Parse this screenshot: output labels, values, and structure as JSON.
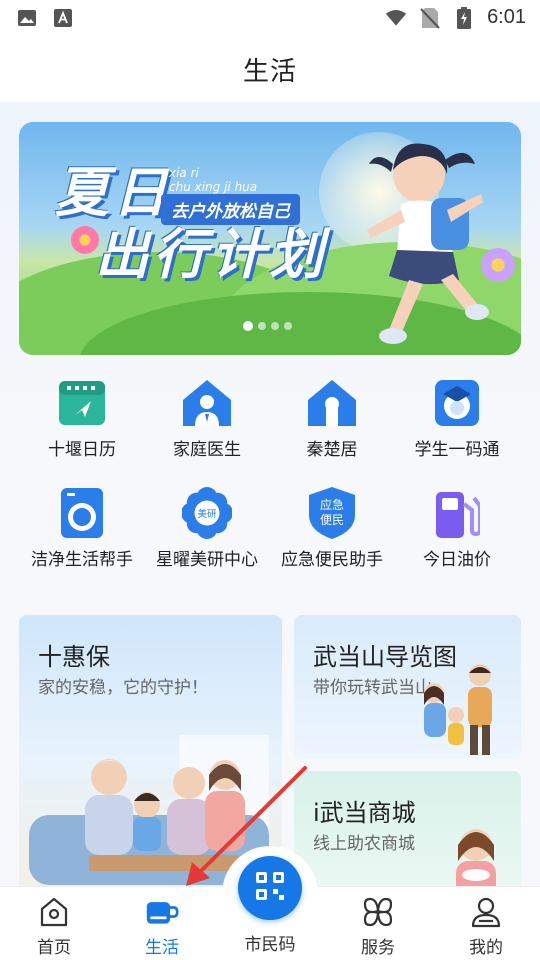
{
  "status_bar": {
    "time": "6:01",
    "left_icons": [
      "image-icon",
      "font-icon"
    ],
    "right_icons": [
      "wifi-icon",
      "no-sim-icon",
      "battery-icon"
    ]
  },
  "header": {
    "title": "生活"
  },
  "banner": {
    "title_line1": "夏日",
    "title_line2": "出行计划",
    "pinyin_line1": "xia ri",
    "pinyin_line2": "chu xing ji hua",
    "tag": "去户外放松自己",
    "page_count": 4,
    "active_page": 0
  },
  "services": [
    {
      "label": "十堰日历",
      "icon": "calendar-icon"
    },
    {
      "label": "家庭医生",
      "icon": "doctor-icon"
    },
    {
      "label": "秦楚居",
      "icon": "house-keyhole-icon"
    },
    {
      "label": "学生一码通",
      "icon": "student-code-icon"
    },
    {
      "label": "洁净生活帮手",
      "icon": "washing-machine-icon"
    },
    {
      "label": "星曜美研中心",
      "icon": "beauty-flower-icon",
      "badge": "美研"
    },
    {
      "label": "应急便民助手",
      "icon": "emergency-shield-icon",
      "badge_line1": "应急",
      "badge_line2": "便民"
    },
    {
      "label": "今日油价",
      "icon": "fuel-pump-icon"
    }
  ],
  "cards": {
    "big": {
      "title": "十惠保",
      "subtitle": "家的安稳，它的守护！"
    },
    "right_top": {
      "title": "武当山导览图",
      "subtitle": "带你玩转武当山"
    },
    "right_bottom": {
      "title": "i武当商城",
      "subtitle": "线上助农商城"
    }
  },
  "tab_bar": {
    "tabs": [
      {
        "label": "首页",
        "icon": "home-icon"
      },
      {
        "label": "生活",
        "icon": "cup-icon",
        "active": true
      },
      {
        "label": "市民码",
        "icon": "qr-code-icon"
      },
      {
        "label": "服务",
        "icon": "services-grid-icon"
      },
      {
        "label": "我的",
        "icon": "profile-icon"
      }
    ]
  },
  "colors": {
    "accent": "#1677e6",
    "annotation_arrow": "#e53935"
  }
}
